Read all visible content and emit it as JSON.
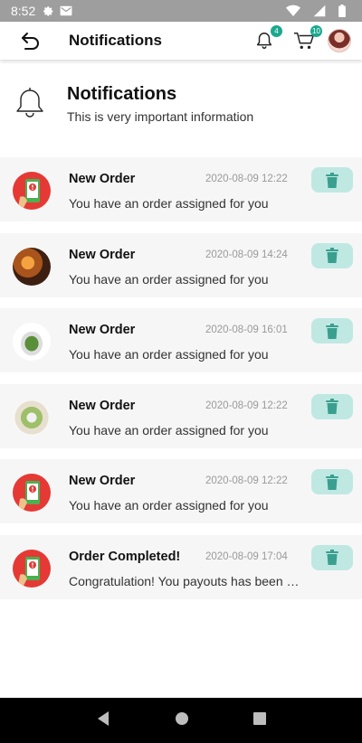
{
  "status_bar": {
    "time": "8:52"
  },
  "app_bar": {
    "title": "Notifications",
    "bell_badge": "4",
    "cart_badge": "10"
  },
  "header": {
    "title": "Notifications",
    "subtitle": "This is very important information"
  },
  "notifications": [
    {
      "title": "New Order",
      "time": "2020-08-09 12:22",
      "message": "You have an order assigned for you",
      "image": "order-phone-icon"
    },
    {
      "title": "New Order",
      "time": "2020-08-09 14:24",
      "message": "You have an order assigned for you",
      "image": "restaurant-photo"
    },
    {
      "title": "New Order",
      "time": "2020-08-09 16:01",
      "message": "You have an order assigned for you",
      "image": "food-plate-photo"
    },
    {
      "title": "New Order",
      "time": "2020-08-09 12:22",
      "message": "You have an order assigned for you",
      "image": "salad-bowl-photo"
    },
    {
      "title": "New Order",
      "time": "2020-08-09 12:22",
      "message": "You have an order assigned for you",
      "image": "order-phone-icon"
    },
    {
      "title": "Order Completed!",
      "time": "2020-08-09 17:04",
      "message": "Congratulation! You payouts has been …",
      "image": "order-phone-icon"
    }
  ],
  "colors": {
    "accent": "#1aa88e",
    "delete_bg": "#bfe8e3",
    "delete_icon": "#3a9f8f",
    "card_bg": "#f6f6f6",
    "status_bar": "#9e9e9e"
  }
}
